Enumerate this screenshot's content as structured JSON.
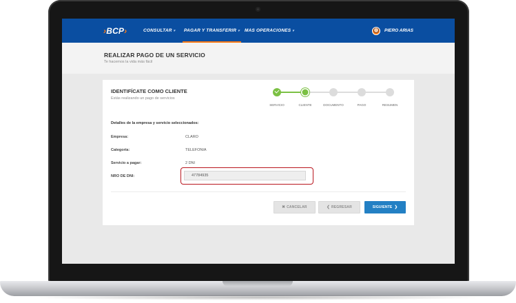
{
  "app": {
    "logo_text": "BCP",
    "logo_glyph_left": "›",
    "logo_glyph_right": "›",
    "brand_color": "#0a4ea1",
    "accent_color": "#ff7a14"
  },
  "navbar": {
    "items": [
      {
        "label": "CONSULTAR",
        "has_dropdown": true,
        "active": false
      },
      {
        "label": "PAGAR Y TRANSFERIR",
        "has_dropdown": true,
        "active": true
      },
      {
        "label": "MAS OPERACIONES",
        "has_dropdown": true,
        "active": false
      }
    ],
    "user_name": "PIERO ARIAS"
  },
  "page": {
    "title": "REALIZAR PAGO DE UN SERVICIO",
    "subtitle": "Te hacemos la vida más fácil"
  },
  "card": {
    "title": "IDENTIFÍCATE COMO CLIENTE",
    "subtitle": "Estás realizando un pago de servicios",
    "stepper": {
      "steps": [
        {
          "label": "SERVICIO",
          "state": "done"
        },
        {
          "label": "CLIENTE",
          "state": "current"
        },
        {
          "label": "DOCUMENTO",
          "state": "pending"
        },
        {
          "label": "PAGO",
          "state": "pending"
        },
        {
          "label": "RESUMEN",
          "state": "pending"
        }
      ],
      "done_color": "#7bc043",
      "pending_color": "#dcdcdc"
    },
    "section_title": "Detalles de la empresa y servicio seleccionados:",
    "details": [
      {
        "label": "Empresa:",
        "value": "CLARO"
      },
      {
        "label": "Categoría:",
        "value": "TELEFONIA"
      },
      {
        "label": "Servicio a pagar:",
        "value": "2 DNI"
      }
    ],
    "dni": {
      "label": "NRO DE DNI:",
      "value": "47784935",
      "highlight_color": "#b8141c"
    },
    "buttons": {
      "cancel_label": "CANCELAR",
      "back_label": "REGRESAR",
      "next_label": "SIGUIENTE",
      "next_color": "#2380c4"
    }
  }
}
